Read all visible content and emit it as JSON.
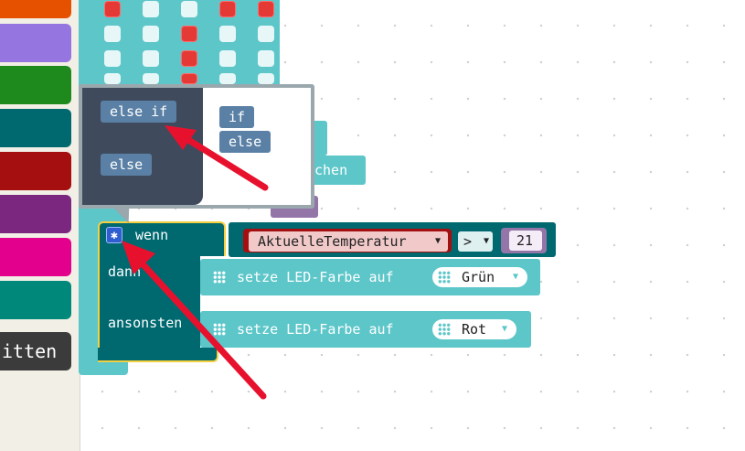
{
  "toolbox": {
    "categories": [
      {
        "name": "orange",
        "color": "#e65100"
      },
      {
        "name": "purple",
        "color": "#9575e0"
      },
      {
        "name": "green",
        "color": "#1e8a1e"
      },
      {
        "name": "teal",
        "color": "#006970"
      },
      {
        "name": "red",
        "color": "#a50f0f"
      },
      {
        "name": "violet",
        "color": "#7b2780"
      },
      {
        "name": "pink",
        "color": "#e3008c"
      },
      {
        "name": "aqua",
        "color": "#00897b"
      }
    ],
    "button_label": "itten"
  },
  "mutator": {
    "flyout_else_if": "else if",
    "flyout_else": "else",
    "workspace_if": "if",
    "workspace_else": "else"
  },
  "partial_text": {
    "chen": "chen"
  },
  "if_block": {
    "wenn": "wenn",
    "dann": "dann",
    "ansonsten": "ansonsten",
    "condition": {
      "variable": "AktuelleTemperatur",
      "operator": ">",
      "value": "21"
    },
    "then_statement": {
      "label": "setze LED-Farbe auf",
      "value": "Grün"
    },
    "else_statement": {
      "label": "setze LED-Farbe auf",
      "value": "Rot"
    }
  },
  "icons": [
    "gear-icon",
    "led-grid-icon",
    "dropdown-caret-icon"
  ],
  "colors": {
    "logic": "#006970",
    "basic": "#5cc6c9",
    "variable": "#a50f0f",
    "math": "#9475a8",
    "highlight_outline": "#f4d03f",
    "arrow": "#e8112d"
  }
}
